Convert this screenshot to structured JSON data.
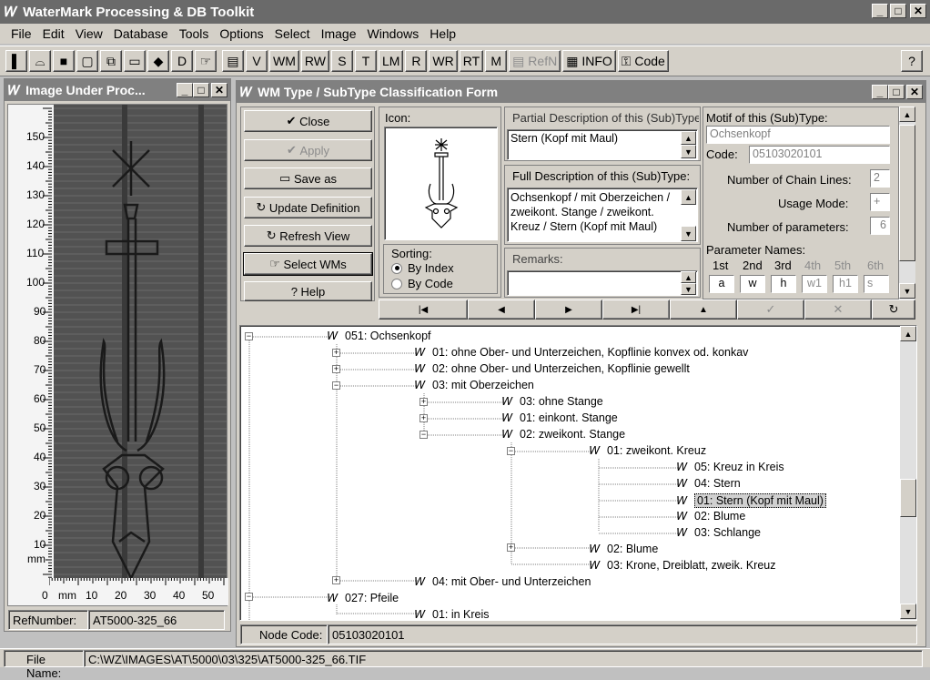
{
  "app": {
    "title": "WaterMark Processing & DB Toolkit"
  },
  "menu": [
    "File",
    "Edit",
    "View",
    "Database",
    "Tools",
    "Options",
    "Select",
    "Image",
    "Windows",
    "Help"
  ],
  "toolbar": {
    "text_buttons": [
      "D",
      "V",
      "WM",
      "RW",
      "S",
      "T",
      "LM",
      "R",
      "WR",
      "RT",
      "M"
    ],
    "refn": "RefN",
    "info": "INFO",
    "code": "Code",
    "help": "?"
  },
  "image_window": {
    "title": "Image Under Proc...",
    "ruler_v": [
      "150",
      "140",
      "130",
      "120",
      "110",
      "100",
      "90",
      "80",
      "70",
      "60",
      "50",
      "40",
      "30",
      "20",
      "10"
    ],
    "ruler_unit": "mm",
    "ruler_h": [
      "0",
      "mm",
      "10",
      "20",
      "30",
      "40",
      "50"
    ],
    "refnumber_label": "RefNumber:",
    "refnumber_value": "AT5000-325_66"
  },
  "form": {
    "title": "WM Type / SubType Classification Form",
    "buttons": {
      "close": "Close",
      "apply": "Apply",
      "save_as": "Save as",
      "update": "Update Definition",
      "refresh": "Refresh View",
      "select_wms": "Select WMs",
      "help": "Help"
    },
    "icon_label": "Icon:",
    "sorting": {
      "label": "Sorting:",
      "by_index": "By Index",
      "by_code": "By Code"
    },
    "partial_desc_label": "Partial Description of this (Sub)Type",
    "partial_desc_value": "Stern (Kopf mit Maul)",
    "full_desc_label": "Full Description of this (Sub)Type:",
    "full_desc_value": "Ochsenkopf / mit Oberzeichen / zweikont. Stange / zweikont. Kreuz / Stern (Kopf mit Maul)",
    "remarks_label": "Remarks:",
    "motif_label": "Motif of this (Sub)Type:",
    "motif_value": "Ochsenkopf",
    "code_label": "Code:",
    "code_value": "05103020101",
    "chain_lines_label": "Number of Chain Lines:",
    "chain_lines_value": "2",
    "usage_label": "Usage Mode:",
    "usage_value": "+",
    "params_label": "Number of parameters:",
    "params_value": "6",
    "param_names_label": "Parameter Names:",
    "param_headers": [
      "1st",
      "2nd",
      "3rd",
      "4th",
      "5th",
      "6th"
    ],
    "param_values": [
      "a",
      "w",
      "h",
      "w1",
      "h1",
      "s"
    ]
  },
  "tree": [
    {
      "text": "051: Ochsenkopf"
    },
    {
      "text": "01: ohne Ober- und Unterzeichen, Kopflinie konvex od. konkav"
    },
    {
      "text": "02: ohne Ober- und Unterzeichen, Kopflinie gewellt"
    },
    {
      "text": "03: mit Oberzeichen"
    },
    {
      "text": "03: ohne Stange"
    },
    {
      "text": "01: einkont. Stange"
    },
    {
      "text": "02: zweikont. Stange"
    },
    {
      "text": "01: zweikont. Kreuz"
    },
    {
      "text": "05: Kreuz in Kreis"
    },
    {
      "text": "04: Stern"
    },
    {
      "text": "01: Stern (Kopf mit Maul)"
    },
    {
      "text": "02: Blume"
    },
    {
      "text": "03: Schlange"
    },
    {
      "text": "02: Blume"
    },
    {
      "text": "03: Krone, Dreiblatt, zweik. Kreuz"
    },
    {
      "text": "04: mit Ober- und Unterzeichen"
    },
    {
      "text": "027: Pfeile"
    },
    {
      "text": "01: in Kreis"
    }
  ],
  "node_code_label": "Node Code:",
  "node_code_value": "05103020101",
  "status": {
    "file_label": "File Name:",
    "file_value": "C:\\WZ\\IMAGES\\AT\\5000\\03\\325\\AT5000-325_66.TIF"
  }
}
